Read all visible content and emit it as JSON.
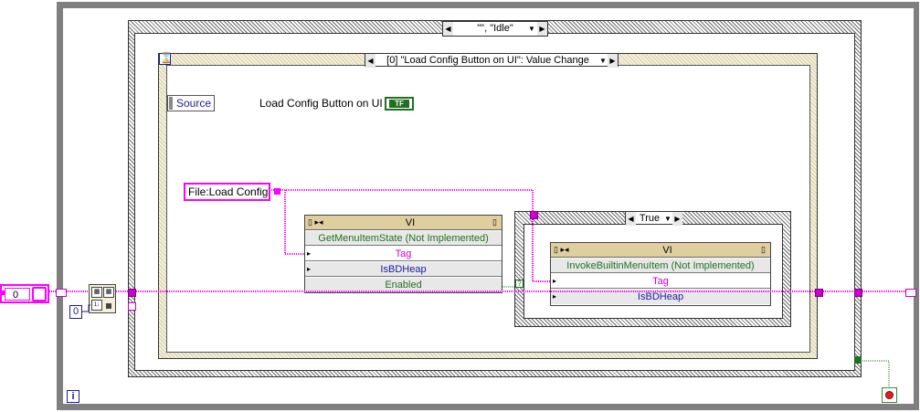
{
  "outer_case": {
    "selector": "\"\", \"Idle\""
  },
  "event_structure": {
    "selector": "[0] \"Load Config Button on UI\": Value Change",
    "timeout_glyph": "⌛",
    "source_label": "Source",
    "control_label": "Load Config Button on UI",
    "bool_terminal": "TF"
  },
  "string_constant": "File:Load Config",
  "get_menu_node": {
    "class": "VI",
    "method": "GetMenuItemState (Not Implemented)",
    "rows": [
      "Tag",
      "IsBDHeap",
      "Enabled"
    ]
  },
  "inner_case": {
    "selector": "True"
  },
  "invoke_node": {
    "class": "VI",
    "method": "InvokeBuiltinMenuItem (Not Implemented)",
    "rows": [
      "Tag",
      "IsBDHeap"
    ]
  },
  "numeric_control_value": "0",
  "int_constant": "0",
  "iteration_terminal": "i",
  "colors": {
    "string_wire": "#ff00ff",
    "bool_wire": "#207020",
    "int_wire": "#1a1aa0",
    "event_frame": "#e0cf9e"
  }
}
